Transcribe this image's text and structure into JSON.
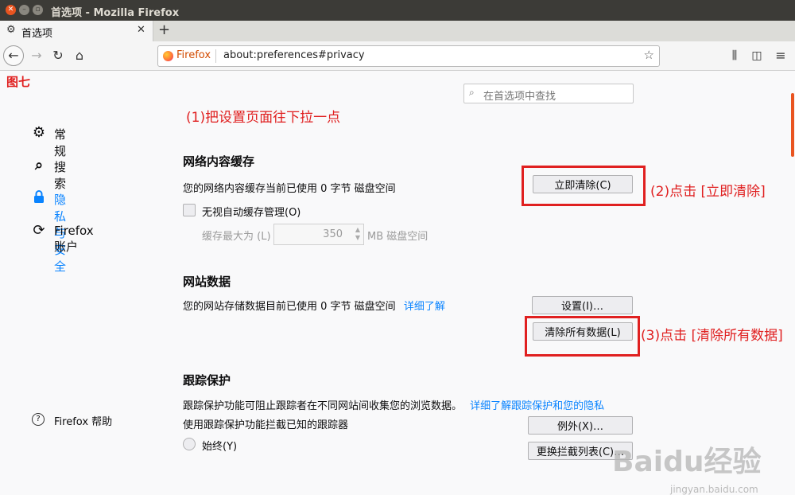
{
  "window": {
    "title": "首选项 - Mozilla Firefox"
  },
  "tab": {
    "title": "首选项"
  },
  "urlbar": {
    "identity": "Firefox",
    "url": "about:preferences#privacy"
  },
  "fig_label": "图七",
  "search": {
    "placeholder": "在首选项中查找"
  },
  "annotations": {
    "step1": "(1)把设置页面往下拉一点",
    "step2": "(2)点击 [立即清除]",
    "step3": "(3)点击 [清除所有数据]"
  },
  "sidebar": {
    "items": [
      {
        "label": "常规",
        "icon": "gear-icon"
      },
      {
        "label": "搜索",
        "icon": "search-icon"
      },
      {
        "label": "隐私与安全",
        "icon": "lock-icon"
      },
      {
        "label": "Firefox 账户",
        "icon": "sync-icon"
      }
    ],
    "help": "Firefox 帮助"
  },
  "cache": {
    "heading": "网络内容缓存",
    "usage": "您的网络内容缓存当前已使用 0 字节 磁盘空间",
    "clear_button": "立即清除(C)",
    "override_label": "无视自动缓存管理(O)",
    "limit_label": "缓存最大为 (L)",
    "limit_value": "350",
    "limit_unit": "MB 磁盘空间"
  },
  "site_data": {
    "heading": "网站数据",
    "usage": "您的网站存储数据目前已使用 0 字节 磁盘空间",
    "learn_more": "详细了解",
    "settings_button": "设置(I)…",
    "clear_all_button": "清除所有数据(L)"
  },
  "tracking": {
    "heading": "跟踪保护",
    "desc": "跟踪保护功能可阻止跟踪者在不同网站间收集您的浏览数据。",
    "learn_more": "详细了解跟踪保护和您的隐私",
    "block_label": "使用跟踪保护功能拦截已知的跟踪器",
    "exceptions_button": "例外(X)…",
    "always_label": "始终(Y)",
    "change_list_button": "更换拦截列表(C)…"
  },
  "watermark": {
    "brand": "Baidu经验",
    "url": "jingyan.baidu.com"
  },
  "colors": {
    "accent": "#0a84ff",
    "annotation": "#e02020"
  }
}
